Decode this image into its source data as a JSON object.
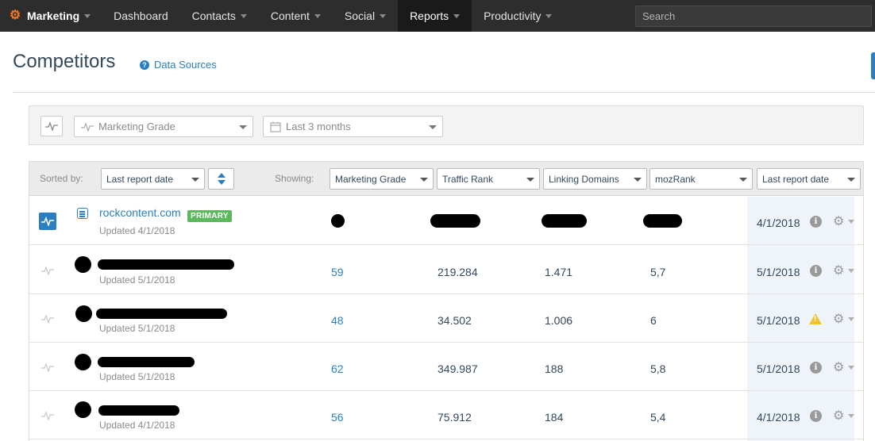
{
  "nav": {
    "brand": "Marketing",
    "items": [
      {
        "label": "Dashboard",
        "caret": false,
        "active": false
      },
      {
        "label": "Contacts",
        "caret": true,
        "active": false
      },
      {
        "label": "Content",
        "caret": true,
        "active": false
      },
      {
        "label": "Social",
        "caret": true,
        "active": false
      },
      {
        "label": "Reports",
        "caret": true,
        "active": true
      },
      {
        "label": "Productivity",
        "caret": true,
        "active": false
      }
    ],
    "search_placeholder": "Search"
  },
  "page": {
    "title": "Competitors",
    "data_sources": "Data Sources"
  },
  "filters": {
    "metric": "Marketing Grade",
    "range": "Last 3 months"
  },
  "table": {
    "sorted_by_label": "Sorted by:",
    "sort_value": "Last report date",
    "showing_label": "Showing:",
    "columns": [
      "Marketing Grade",
      "Traffic Rank",
      "Linking Domains",
      "mozRank",
      "Last report date"
    ],
    "primary_badge": "PRIMARY",
    "rows": [
      {
        "name": "rockcontent.com",
        "updated": "Updated 4/1/2018",
        "grade": "",
        "traffic": "",
        "linking": "",
        "moz": "",
        "date": "4/1/2018",
        "status": "info",
        "primary": true
      },
      {
        "name": "",
        "updated": "Updated 5/1/2018",
        "grade": "59",
        "traffic": "219.284",
        "linking": "1.471",
        "moz": "5,7",
        "date": "5/1/2018",
        "status": "info",
        "primary": false
      },
      {
        "name": "",
        "updated": "Updated 5/1/2018",
        "grade": "48",
        "traffic": "34.502",
        "linking": "1.006",
        "moz": "6",
        "date": "5/1/2018",
        "status": "warning",
        "primary": false
      },
      {
        "name": "",
        "updated": "Updated 5/1/2018",
        "grade": "62",
        "traffic": "349.987",
        "linking": "188",
        "moz": "5,8",
        "date": "5/1/2018",
        "status": "info",
        "primary": false
      },
      {
        "name": "",
        "updated": "Updated 4/1/2018",
        "grade": "56",
        "traffic": "75.912",
        "linking": "184",
        "moz": "5,4",
        "date": "4/1/2018",
        "status": "info",
        "primary": false
      }
    ]
  },
  "colors": {
    "accent": "#2a7fc1",
    "nav_bg": "#2d2d2d",
    "primary_badge": "#5cb85c",
    "warning": "#f2c12e",
    "brand": "#f57722"
  }
}
